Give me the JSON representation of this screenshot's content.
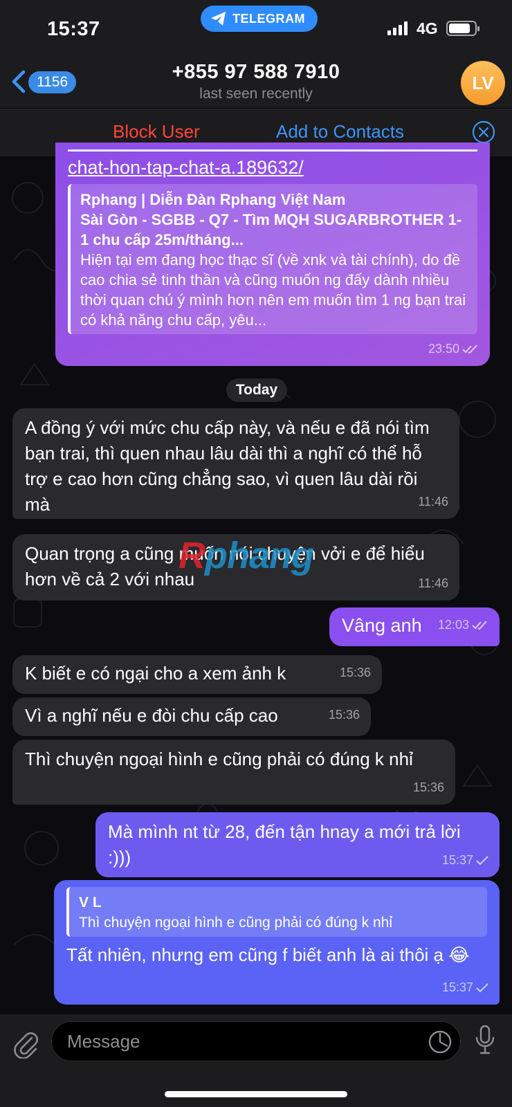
{
  "status_bar": {
    "time": "15:37",
    "app_label": "TELEGRAM",
    "network": "4G"
  },
  "header": {
    "unread_count": "1156",
    "contact_name": "+855 97 588 7910",
    "last_seen": "last seen recently",
    "avatar_initials": "LV"
  },
  "action_bar": {
    "block_label": "Block User",
    "add_label": "Add to Contacts"
  },
  "messages": [
    {
      "direction": "out",
      "link_text": "chat-hon-tap-chat-a.189632/",
      "preview_title": "Rphang | Diễn Đàn Rphang Việt Nam",
      "preview_subtitle": "Sài Gòn - SGBB - Q7 - Tìm MQH SUGARBROTHER 1-1 chu cấp 25m/tháng...",
      "preview_body": "Hiện tại em đang học thạc sĩ (về xnk và tài chính), do đề cao chia sẻ tinh thần và cũng muốn ng đấy dành nhiều thời quan chú ý mình hơn nên em muốn tìm 1 ng bạn trai có khả năng chu cấp, yêu...",
      "time": "23:50"
    },
    {
      "direction": "in",
      "text": "A đồng ý với mức chu cấp này, và nếu e đã nói tìm bạn trai, thì quen nhau lâu dài thì a nghĩ có thể hỗ trợ e cao hơn cũng chẳng sao, vì quen lâu dài rồi mà",
      "time": "11:46"
    },
    {
      "direction": "in",
      "text": "Quan trọng a cũng muốn nói chuyện vởi e để hiểu hơn về cả 2 với nhau",
      "time": "11:46"
    },
    {
      "direction": "out",
      "text": "Vâng anh",
      "time": "12:03"
    },
    {
      "direction": "in",
      "text": "K biết e có ngại cho a xem ảnh k",
      "time": "15:36"
    },
    {
      "direction": "in",
      "text": "Vì a nghĩ nếu e đòi chu cấp cao",
      "time": "15:36"
    },
    {
      "direction": "in",
      "text": "Thì chuyện ngoại hình e cũng phải có đúng k nhỉ",
      "time": "15:36"
    },
    {
      "direction": "out",
      "text": "Mà mình nt từ 28, đến tận hnay a mới trả lời :)))",
      "time": "15:37"
    },
    {
      "direction": "out",
      "reply_name": "V L",
      "reply_text": "Thì chuyện ngoại hình e cũng phải có đúng k nhỉ",
      "text": "Tất nhiên, nhưng em cũng f biết anh là ai thôi ạ 😂",
      "time": "15:37"
    }
  ],
  "date_divider": "Today",
  "watermark": {
    "first": "R",
    "rest": "phang"
  },
  "input": {
    "placeholder": "Message"
  },
  "colors": {
    "accent": "#3d95f5",
    "danger": "#ff453a",
    "incoming_bubble": "#2a2a2e",
    "outgoing_purple": "#9a4be6",
    "outgoing_blue": "#5b63f5"
  }
}
